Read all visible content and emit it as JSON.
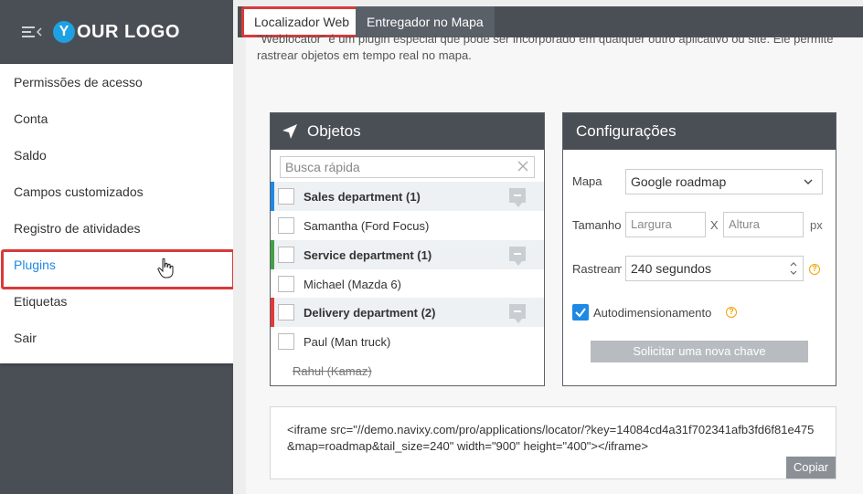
{
  "sidebar": {
    "logo_letter": "Y",
    "logo_text": "OUR LOGO",
    "menu": [
      {
        "label": "Permissões de acesso"
      },
      {
        "label": "Conta"
      },
      {
        "label": "Saldo"
      },
      {
        "label": "Campos customizados"
      },
      {
        "label": "Registro de atividades"
      },
      {
        "label": "Plugins"
      },
      {
        "label": "Etiquetas"
      },
      {
        "label": "Sair"
      }
    ]
  },
  "tabs": {
    "active": "Localizador Web",
    "inactive": "Entregador no Mapa"
  },
  "description": "\"Weblocator\" é um plugin especial que pode ser incorporado em qualquer outro aplicativo ou site. Ele permite rastrear objetos em tempo real no mapa.",
  "objects": {
    "title": "Objetos",
    "search_placeholder": "Busca rápida",
    "rows": [
      {
        "label": "Sales department (1)",
        "type": "group",
        "color": "#1e88e5"
      },
      {
        "label": "Samantha (Ford Focus)",
        "type": "item"
      },
      {
        "label": "Service department (1)",
        "type": "group",
        "color": "#43a047"
      },
      {
        "label": "Michael (Mazda 6)",
        "type": "item"
      },
      {
        "label": "Delivery department (2)",
        "type": "group",
        "color": "#e53935"
      },
      {
        "label": "Paul (Man truck)",
        "type": "item"
      },
      {
        "label": "Rahul (Kamaz)",
        "type": "strike"
      }
    ]
  },
  "settings": {
    "title": "Configurações",
    "map_label": "Mapa",
    "map_value": "Google roadmap",
    "size_label": "Tamanho",
    "width_placeholder": "Largura",
    "x_sep": "X",
    "height_placeholder": "Altura",
    "size_unit": "px",
    "track_label": "Rastreamento",
    "track_value": "240  segundos",
    "autosize_label": "Autodimensionamento",
    "request_key_button": "Solicitar uma nova chave"
  },
  "code": {
    "text": "<iframe src=\"//demo.navixy.com/pro/applications/locator/?key=14084cd4a31f702341afb3fd6f81e475&map=roadmap&tail_size=240\" width=\"900\" height=\"400\"></iframe>",
    "copy_button": "Copiar"
  },
  "colors": {
    "sidebar_bg": "#4a4f55",
    "accent_blue": "#1e88e5",
    "highlight_red": "#d93a3a",
    "help_orange": "#f0a500"
  }
}
